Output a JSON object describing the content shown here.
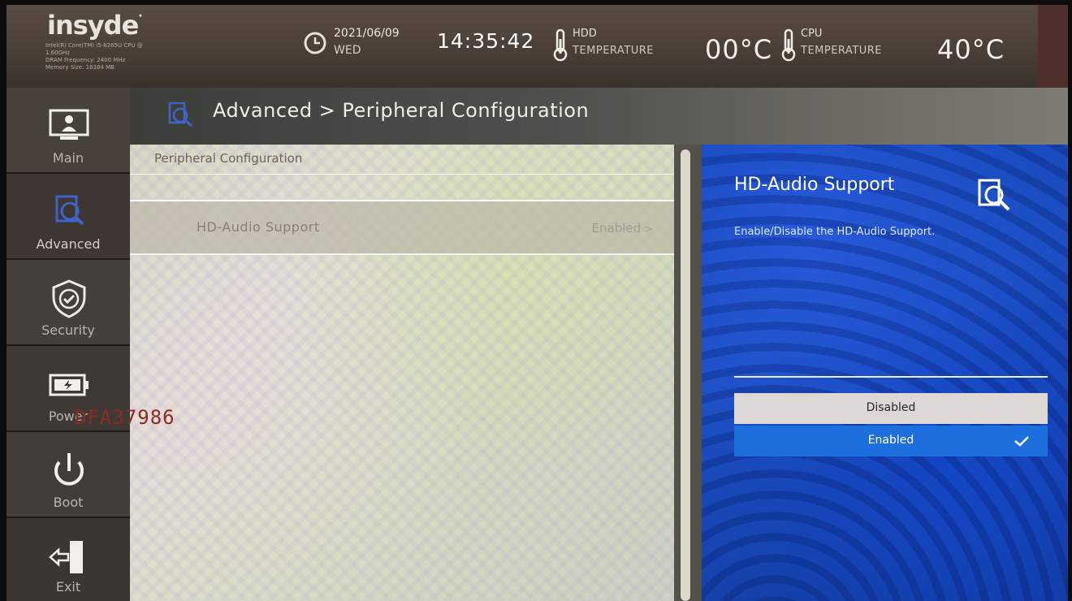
{
  "header": {
    "logo": "insyde",
    "logo_mark": "·",
    "sysinfo": [
      "Intel(R) Core(TM) i5-8265U CPU @",
      "1.60GHz",
      "DRAM Frequency: 2400 MHz",
      "Memory Size: 16384 MB"
    ],
    "date": "2021/06/09",
    "day": "WED",
    "time": "14:35:42",
    "hdd": {
      "label1": "HDD",
      "label2": "TEMPERATURE",
      "value": "00°C"
    },
    "cpu": {
      "label1": "CPU",
      "label2": "TEMPERATURE",
      "value": "40°C"
    }
  },
  "sidebar": {
    "items": [
      {
        "label": "Main",
        "icon": "monitor-user-icon"
      },
      {
        "label": "Advanced",
        "icon": "magnifier-document-icon"
      },
      {
        "label": "Security",
        "icon": "shield-check-icon"
      },
      {
        "label": "Power",
        "icon": "battery-icon"
      },
      {
        "label": "Boot",
        "icon": "power-icon"
      },
      {
        "label": "Exit",
        "icon": "exit-door-icon"
      }
    ]
  },
  "breadcrumb": "Advanced > Peripheral Configuration",
  "main": {
    "section_title": "Peripheral Configuration",
    "rows": [
      {
        "label": "HD-Audio Support",
        "value": "Enabled",
        "arrow": ">"
      }
    ]
  },
  "help": {
    "title": "HD-Audio Support",
    "description": "Enable/Disable the HD-Audio Support.",
    "options": [
      {
        "label": "Disabled",
        "selected": false
      },
      {
        "label": "Enabled",
        "selected": true
      }
    ]
  },
  "overlay_stamp": "DFA37986",
  "colors": {
    "selected_option": "#1d6fde",
    "help_panel": "#1747b8"
  }
}
